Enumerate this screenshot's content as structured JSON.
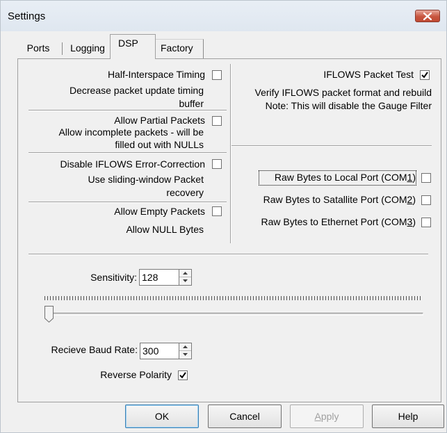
{
  "window": {
    "title": "Settings",
    "close_icon": "close-x-icon",
    "close_color": "#c8553f"
  },
  "tabs": [
    {
      "label": "Ports",
      "active": false
    },
    {
      "label": "Logging",
      "active": false
    },
    {
      "label": "DSP",
      "active": true
    },
    {
      "label": "Factory",
      "active": false
    }
  ],
  "left_options": [
    {
      "label": "Half-Interspace Timing",
      "checked": false,
      "desc": [
        "Decrease packet update timing",
        "buffer"
      ]
    },
    {
      "label": "Allow Partial Packets",
      "checked": false,
      "desc": [
        "Allow incomplete packets - will be",
        "filled out with NULLs"
      ]
    },
    {
      "label": "Disable IFLOWS Error-Correction",
      "checked": false,
      "desc": [
        "Use sliding-window Packet",
        "recovery"
      ]
    },
    {
      "label": "Allow Empty Packets",
      "checked": false,
      "desc": [
        "Allow NULL Bytes"
      ]
    }
  ],
  "ifflows_test": {
    "label": "IFLOWS Packet Test",
    "checked": true,
    "desc": [
      "Verify IFLOWS packet format and rebuild",
      "Note: This will disable the Gauge Filter"
    ]
  },
  "raw_ports": [
    {
      "prefix": "Raw Bytes to Local Port (COM",
      "mnemonic": "1",
      "suffix": ")",
      "checked": false
    },
    {
      "prefix": "Raw Bytes to Satallite Port (COM",
      "mnemonic": "2",
      "suffix": ")",
      "checked": false
    },
    {
      "prefix": "Raw Bytes to Ethernet Port (COM",
      "mnemonic": "3",
      "suffix": ")",
      "checked": false
    }
  ],
  "sensitivity": {
    "label": "Sensitivity:",
    "value": "128",
    "slider_fraction": 0.0
  },
  "baud": {
    "label": "Recieve Baud Rate:",
    "value": "300"
  },
  "reverse_polarity": {
    "label": "Reverse Polarity",
    "checked": true
  },
  "buttons": {
    "ok": "OK",
    "cancel": "Cancel",
    "apply": "Apply",
    "apply_mnemonic": "A",
    "apply_rest": "pply",
    "help": "Help"
  }
}
